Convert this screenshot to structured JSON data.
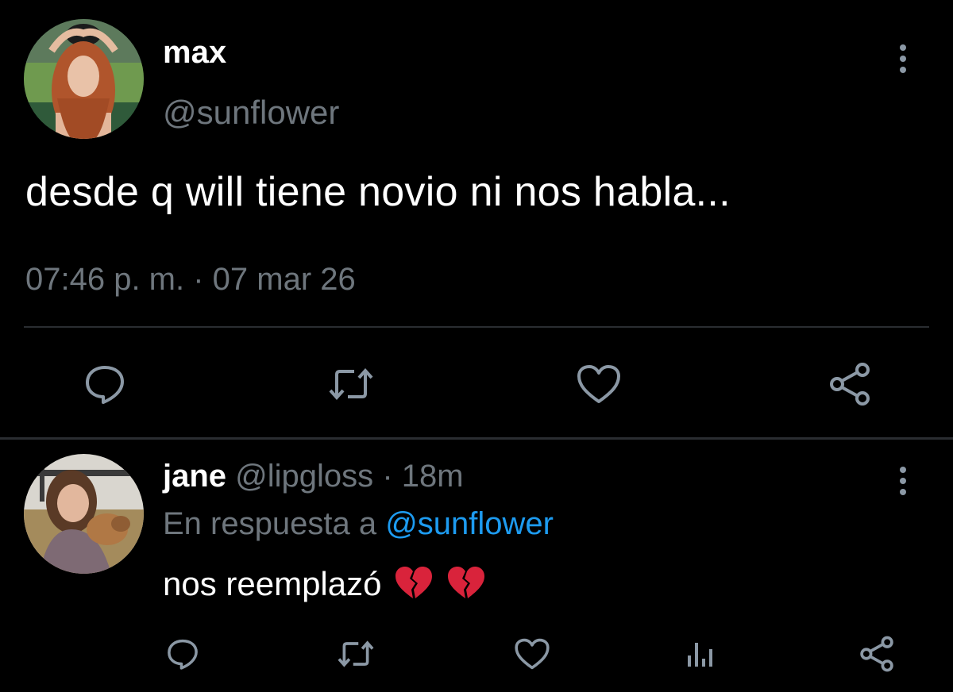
{
  "colors": {
    "background": "#000000",
    "text_primary": "#ffffff",
    "text_secondary": "#6e767d",
    "link": "#1d9bf0",
    "divider": "#2a2d31",
    "icon": "#8b98a5"
  },
  "main_tweet": {
    "display_name": "max",
    "handle": "@sunflower",
    "text": "desde q will tiene novio ni nos habla...",
    "timestamp": "07:46 p. m. · 07 mar 26",
    "actions": [
      "reply-icon",
      "retweet-icon",
      "like-icon",
      "share-icon"
    ]
  },
  "reply_tweet": {
    "display_name": "jane",
    "handle": "@lipgloss",
    "separator": "·",
    "time_ago": "18m",
    "reply_context_prefix": "En respuesta a",
    "reply_context_mention": "@sunflower",
    "text": "nos reemplazó",
    "emoji": [
      "broken-heart",
      "broken-heart"
    ],
    "actions": [
      "reply-icon",
      "retweet-icon",
      "like-icon",
      "stats-icon",
      "share-icon"
    ]
  }
}
